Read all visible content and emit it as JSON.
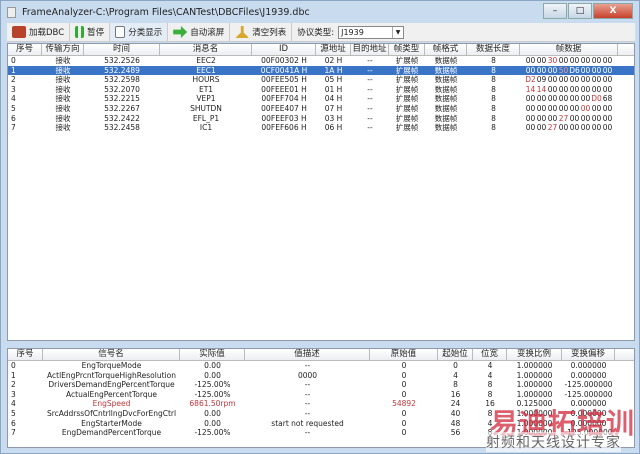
{
  "window": {
    "title": "FrameAnalyzer-C:\\Program Files\\CANTest\\DBCFiles\\J1939.dbc",
    "minimize": "–",
    "maximize": "□",
    "close": "X"
  },
  "toolbar": {
    "load_dbc": "加载DBC",
    "pause": "暂停",
    "classify": "分类显示",
    "auto_scroll": "自动滚屏",
    "clear": "清空列表",
    "protocol_label": "协议类型:",
    "protocol_value": "J1939"
  },
  "frames": {
    "columns": [
      "序号",
      "传输方向",
      "时间",
      "消息名",
      "ID",
      "源地址",
      "目的地址",
      "帧类型",
      "帧格式",
      "数据长度",
      "帧数据"
    ],
    "selected_index": 1,
    "rows": [
      {
        "no": "0",
        "dir": "接收",
        "time": "532.2526",
        "name": "EEC2",
        "id": "00F00302 H",
        "src": "02 H",
        "dst": "--",
        "type": "扩展帧",
        "fmt": "数据帧",
        "len": "8",
        "data": [
          "00",
          "00",
          "30",
          "00",
          "00",
          "00",
          "00",
          "00"
        ],
        "red": [
          2
        ]
      },
      {
        "no": "1",
        "dir": "接收",
        "time": "532.2489",
        "name": "EEC1",
        "id": "0CF0041A H",
        "src": "1A H",
        "dst": "--",
        "type": "扩展帧",
        "fmt": "数据帧",
        "len": "8",
        "data": [
          "00",
          "00",
          "00",
          "50",
          "D6",
          "00",
          "00",
          "00"
        ],
        "red": [
          3
        ]
      },
      {
        "no": "2",
        "dir": "接收",
        "time": "532.2598",
        "name": "HOURS",
        "id": "00FEE505 H",
        "src": "05 H",
        "dst": "--",
        "type": "扩展帧",
        "fmt": "数据帧",
        "len": "8",
        "data": [
          "D2",
          "09",
          "00",
          "00",
          "00",
          "00",
          "00",
          "00"
        ],
        "red": [
          0
        ]
      },
      {
        "no": "3",
        "dir": "接收",
        "time": "532.2070",
        "name": "ET1",
        "id": "00FEEE01 H",
        "src": "01 H",
        "dst": "--",
        "type": "扩展帧",
        "fmt": "数据帧",
        "len": "8",
        "data": [
          "14",
          "14",
          "00",
          "00",
          "00",
          "00",
          "00",
          "00"
        ],
        "red": [
          0,
          1
        ]
      },
      {
        "no": "4",
        "dir": "接收",
        "time": "532.2215",
        "name": "VEP1",
        "id": "00FEF704 H",
        "src": "04 H",
        "dst": "--",
        "type": "扩展帧",
        "fmt": "数据帧",
        "len": "8",
        "data": [
          "00",
          "00",
          "00",
          "00",
          "00",
          "00",
          "D0",
          "68"
        ],
        "red": [
          6
        ]
      },
      {
        "no": "5",
        "dir": "接收",
        "time": "532.2267",
        "name": "SHUTDN",
        "id": "00FEE407 H",
        "src": "07 H",
        "dst": "--",
        "type": "扩展帧",
        "fmt": "数据帧",
        "len": "8",
        "data": [
          "00",
          "00",
          "00",
          "00",
          "00",
          "00",
          "00",
          "00"
        ],
        "red": [
          5
        ]
      },
      {
        "no": "6",
        "dir": "接收",
        "time": "532.2422",
        "name": "EFL_P1",
        "id": "00FEEF03 H",
        "src": "03 H",
        "dst": "--",
        "type": "扩展帧",
        "fmt": "数据帧",
        "len": "8",
        "data": [
          "00",
          "00",
          "00",
          "27",
          "00",
          "00",
          "00",
          "00"
        ],
        "red": [
          3
        ]
      },
      {
        "no": "7",
        "dir": "接收",
        "time": "532.2458",
        "name": "IC1",
        "id": "00FEF606 H",
        "src": "06 H",
        "dst": "--",
        "type": "扩展帧",
        "fmt": "数据帧",
        "len": "8",
        "data": [
          "00",
          "00",
          "27",
          "00",
          "00",
          "00",
          "00",
          "00"
        ],
        "red": [
          2
        ]
      }
    ]
  },
  "signals": {
    "columns": [
      "序号",
      "信号名",
      "实际值",
      "值描述",
      "原始值",
      "起始位",
      "位宽",
      "变换比例",
      "变换偏移"
    ],
    "rows": [
      {
        "no": "0",
        "name": "EngTorqueMode",
        "value": "0.00",
        "desc": "--",
        "raw": "0",
        "start": "0",
        "width": "4",
        "scale": "1.000000",
        "offset": "0.000000",
        "red": false
      },
      {
        "no": "1",
        "name": "ActlEngPrcntTorqueHighResolution",
        "value": "0.00",
        "desc": "0000",
        "raw": "0",
        "start": "4",
        "width": "4",
        "scale": "1.000000",
        "offset": "0.000000",
        "red": false
      },
      {
        "no": "2",
        "name": "DriversDemandEngPercentTorque",
        "value": "-125.00%",
        "desc": "--",
        "raw": "0",
        "start": "8",
        "width": "8",
        "scale": "1.000000",
        "offset": "-125.000000",
        "red": false
      },
      {
        "no": "3",
        "name": "ActualEngPercentTorque",
        "value": "-125.00%",
        "desc": "--",
        "raw": "0",
        "start": "16",
        "width": "8",
        "scale": "1.000000",
        "offset": "-125.000000",
        "red": false
      },
      {
        "no": "4",
        "name": "EngSpeed",
        "value": "6861.50rpm",
        "desc": "--",
        "raw": "54892",
        "start": "24",
        "width": "16",
        "scale": "0.125000",
        "offset": "0.000000",
        "red": true
      },
      {
        "no": "5",
        "name": "SrcAddrssOfCntrllngDvcForEngCtrl",
        "value": "0.00",
        "desc": "--",
        "raw": "0",
        "start": "40",
        "width": "8",
        "scale": "1.000000",
        "offset": "0.000000",
        "red": false
      },
      {
        "no": "6",
        "name": "EngStarterMode",
        "value": "0.00",
        "desc": "start not requested",
        "raw": "0",
        "start": "48",
        "width": "4",
        "scale": "1.000000",
        "offset": "0.000000",
        "red": false
      },
      {
        "no": "7",
        "name": "EngDemandPercentTorque",
        "value": "-125.00%",
        "desc": "--",
        "raw": "0",
        "start": "56",
        "width": "8",
        "scale": "1.000000",
        "offset": "-125.000000",
        "red": false
      }
    ]
  },
  "watermark": {
    "line1": "易迪拓培训",
    "line2": "射频和天线设计专家"
  },
  "colors": {
    "selection": "#3a74c6",
    "highlight_red": "#c2353a"
  }
}
